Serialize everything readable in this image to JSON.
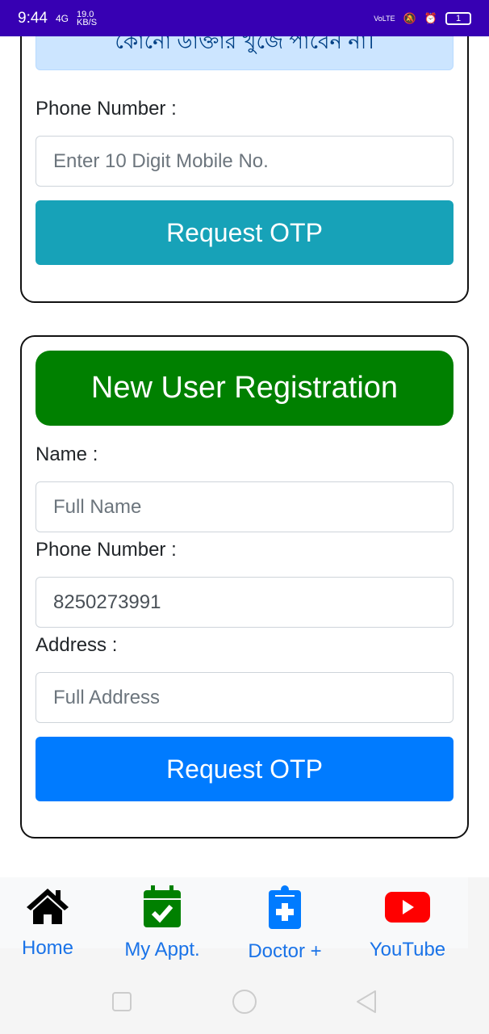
{
  "status_bar": {
    "time": "9:44",
    "network": "4G",
    "speed": "19.0",
    "speed_unit": "KB/S",
    "volte": "VoLTE",
    "battery": "1"
  },
  "login": {
    "notice": "কোনো ডাক্তার খুঁজে পাবেন না।",
    "phone_label": "Phone Number :",
    "phone_placeholder": "Enter 10 Digit Mobile No.",
    "button": "Request OTP",
    "button_color": "#17a2b8"
  },
  "register": {
    "title": "New User Registration",
    "title_color": "#008000",
    "name_label": "Name :",
    "name_placeholder": "Full Name",
    "phone_label": "Phone Number :",
    "phone_value": "8250273991",
    "address_label": "Address :",
    "address_placeholder": "Full Address",
    "button": "Request OTP",
    "button_color": "#007bff"
  },
  "bottom_nav": [
    {
      "label": "Home",
      "icon": "home-icon"
    },
    {
      "label": "My Appt.",
      "icon": "calendar-check-icon"
    },
    {
      "label": "Doctor +",
      "icon": "clipboard-medical-icon"
    },
    {
      "label": "YouTube",
      "icon": "youtube-icon"
    }
  ]
}
